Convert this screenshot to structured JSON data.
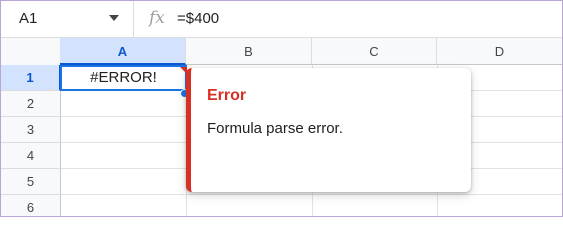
{
  "formula_bar": {
    "name_box": "A1",
    "fx_icon": "fx-icon",
    "formula": "=$400"
  },
  "columns": [
    "A",
    "B",
    "C",
    "D"
  ],
  "rows": [
    "1",
    "2",
    "3",
    "4",
    "5",
    "6"
  ],
  "cells": {
    "A1": "#ERROR!"
  },
  "tooltip": {
    "title": "Error",
    "message": "Formula parse error."
  },
  "colors": {
    "accent": "#1a73e8",
    "error": "#d93025",
    "header_selected": "#d3e3fd"
  }
}
